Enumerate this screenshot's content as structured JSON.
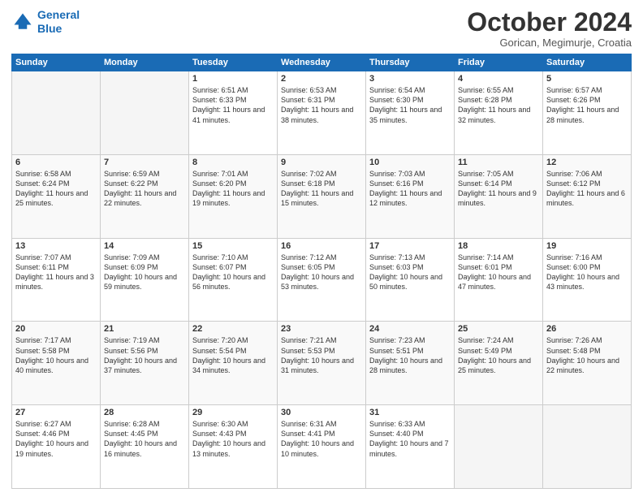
{
  "header": {
    "logo_line1": "General",
    "logo_line2": "Blue",
    "month": "October 2024",
    "location": "Gorican, Megimurje, Croatia"
  },
  "weekdays": [
    "Sunday",
    "Monday",
    "Tuesday",
    "Wednesday",
    "Thursday",
    "Friday",
    "Saturday"
  ],
  "weeks": [
    [
      {
        "day": "",
        "info": ""
      },
      {
        "day": "",
        "info": ""
      },
      {
        "day": "1",
        "info": "Sunrise: 6:51 AM\nSunset: 6:33 PM\nDaylight: 11 hours and 41 minutes."
      },
      {
        "day": "2",
        "info": "Sunrise: 6:53 AM\nSunset: 6:31 PM\nDaylight: 11 hours and 38 minutes."
      },
      {
        "day": "3",
        "info": "Sunrise: 6:54 AM\nSunset: 6:30 PM\nDaylight: 11 hours and 35 minutes."
      },
      {
        "day": "4",
        "info": "Sunrise: 6:55 AM\nSunset: 6:28 PM\nDaylight: 11 hours and 32 minutes."
      },
      {
        "day": "5",
        "info": "Sunrise: 6:57 AM\nSunset: 6:26 PM\nDaylight: 11 hours and 28 minutes."
      }
    ],
    [
      {
        "day": "6",
        "info": "Sunrise: 6:58 AM\nSunset: 6:24 PM\nDaylight: 11 hours and 25 minutes."
      },
      {
        "day": "7",
        "info": "Sunrise: 6:59 AM\nSunset: 6:22 PM\nDaylight: 11 hours and 22 minutes."
      },
      {
        "day": "8",
        "info": "Sunrise: 7:01 AM\nSunset: 6:20 PM\nDaylight: 11 hours and 19 minutes."
      },
      {
        "day": "9",
        "info": "Sunrise: 7:02 AM\nSunset: 6:18 PM\nDaylight: 11 hours and 15 minutes."
      },
      {
        "day": "10",
        "info": "Sunrise: 7:03 AM\nSunset: 6:16 PM\nDaylight: 11 hours and 12 minutes."
      },
      {
        "day": "11",
        "info": "Sunrise: 7:05 AM\nSunset: 6:14 PM\nDaylight: 11 hours and 9 minutes."
      },
      {
        "day": "12",
        "info": "Sunrise: 7:06 AM\nSunset: 6:12 PM\nDaylight: 11 hours and 6 minutes."
      }
    ],
    [
      {
        "day": "13",
        "info": "Sunrise: 7:07 AM\nSunset: 6:11 PM\nDaylight: 11 hours and 3 minutes."
      },
      {
        "day": "14",
        "info": "Sunrise: 7:09 AM\nSunset: 6:09 PM\nDaylight: 10 hours and 59 minutes."
      },
      {
        "day": "15",
        "info": "Sunrise: 7:10 AM\nSunset: 6:07 PM\nDaylight: 10 hours and 56 minutes."
      },
      {
        "day": "16",
        "info": "Sunrise: 7:12 AM\nSunset: 6:05 PM\nDaylight: 10 hours and 53 minutes."
      },
      {
        "day": "17",
        "info": "Sunrise: 7:13 AM\nSunset: 6:03 PM\nDaylight: 10 hours and 50 minutes."
      },
      {
        "day": "18",
        "info": "Sunrise: 7:14 AM\nSunset: 6:01 PM\nDaylight: 10 hours and 47 minutes."
      },
      {
        "day": "19",
        "info": "Sunrise: 7:16 AM\nSunset: 6:00 PM\nDaylight: 10 hours and 43 minutes."
      }
    ],
    [
      {
        "day": "20",
        "info": "Sunrise: 7:17 AM\nSunset: 5:58 PM\nDaylight: 10 hours and 40 minutes."
      },
      {
        "day": "21",
        "info": "Sunrise: 7:19 AM\nSunset: 5:56 PM\nDaylight: 10 hours and 37 minutes."
      },
      {
        "day": "22",
        "info": "Sunrise: 7:20 AM\nSunset: 5:54 PM\nDaylight: 10 hours and 34 minutes."
      },
      {
        "day": "23",
        "info": "Sunrise: 7:21 AM\nSunset: 5:53 PM\nDaylight: 10 hours and 31 minutes."
      },
      {
        "day": "24",
        "info": "Sunrise: 7:23 AM\nSunset: 5:51 PM\nDaylight: 10 hours and 28 minutes."
      },
      {
        "day": "25",
        "info": "Sunrise: 7:24 AM\nSunset: 5:49 PM\nDaylight: 10 hours and 25 minutes."
      },
      {
        "day": "26",
        "info": "Sunrise: 7:26 AM\nSunset: 5:48 PM\nDaylight: 10 hours and 22 minutes."
      }
    ],
    [
      {
        "day": "27",
        "info": "Sunrise: 6:27 AM\nSunset: 4:46 PM\nDaylight: 10 hours and 19 minutes."
      },
      {
        "day": "28",
        "info": "Sunrise: 6:28 AM\nSunset: 4:45 PM\nDaylight: 10 hours and 16 minutes."
      },
      {
        "day": "29",
        "info": "Sunrise: 6:30 AM\nSunset: 4:43 PM\nDaylight: 10 hours and 13 minutes."
      },
      {
        "day": "30",
        "info": "Sunrise: 6:31 AM\nSunset: 4:41 PM\nDaylight: 10 hours and 10 minutes."
      },
      {
        "day": "31",
        "info": "Sunrise: 6:33 AM\nSunset: 4:40 PM\nDaylight: 10 hours and 7 minutes."
      },
      {
        "day": "",
        "info": ""
      },
      {
        "day": "",
        "info": ""
      }
    ]
  ]
}
